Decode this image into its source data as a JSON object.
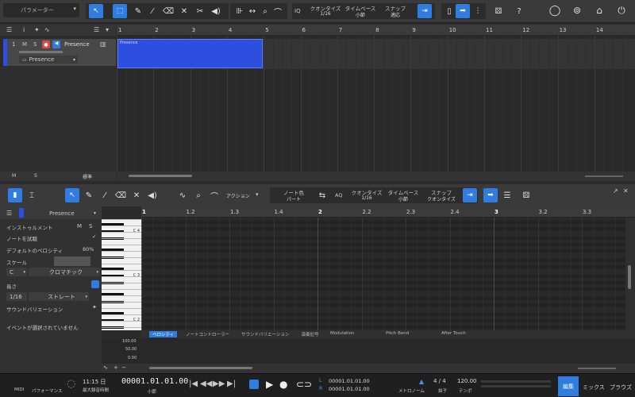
{
  "toolbar": {
    "parameter_label": "パラメーター",
    "quantize": {
      "label": "クオンタイズ",
      "value": "1/16"
    },
    "timebase": {
      "label": "タイムベース",
      "value": "小節"
    },
    "snap": {
      "label": "スナップ",
      "value": "適応"
    },
    "iq": "IQ",
    "help": "?"
  },
  "track": {
    "number": "1",
    "mute": "M",
    "solo": "S",
    "name": "Presence",
    "instrument": "Presence",
    "footer_m": "M",
    "footer_s": "S",
    "footer_std": "標準"
  },
  "arrange": {
    "ruler": [
      "1",
      "2",
      "3",
      "4",
      "5",
      "6",
      "7",
      "8",
      "9",
      "10",
      "11",
      "12",
      "13",
      "14"
    ],
    "event_label": "Presence"
  },
  "editor": {
    "instrument_name": "Presence",
    "action_label": "アクション",
    "note_color": {
      "label": "ノート色",
      "value": "パート"
    },
    "aq": "AQ",
    "quantize": {
      "label": "クオンタイズ",
      "value": "1/16"
    },
    "timebase": {
      "label": "タイムベース",
      "value": "小節"
    },
    "snap": {
      "label": "スナップ",
      "value": "クオンタイズ"
    },
    "inspector": {
      "instrument": "インストゥルメント",
      "m": "M",
      "s": "S",
      "audition": "ノートを試聴",
      "default_velocity": "デフォルトのベロシティ",
      "default_velocity_value": "80%",
      "scale": "スケール",
      "scale_root": "C",
      "scale_type": "クロマチック",
      "length": "長さ",
      "length_value": "1/16",
      "length_mode": "ストレート",
      "sound_variation": "サウンドバリエーション",
      "no_event": "イベントが選択されていません"
    },
    "ruler": [
      "1",
      "1.2",
      "1.3",
      "1.4",
      "2",
      "2.2",
      "2.3",
      "2.4",
      "3",
      "3.2",
      "3.3"
    ],
    "keys": [
      "C 4",
      "C 3",
      "C 2"
    ],
    "lane_tabs": [
      "ベロシティ",
      "ノートコントローラー",
      "サウンドバリエーション",
      "演奏記号",
      "Modulation",
      "Pitch Bend",
      "After Touch"
    ],
    "lane_values": [
      "100.00",
      "50.00",
      "0.00"
    ]
  },
  "transport": {
    "midi": "MIDI",
    "performance": "パフォーマンス",
    "time": "11:15 日",
    "max_rec": "最大録音時間",
    "position": "00001.01.01.00",
    "position_unit": "小節",
    "l_label": "L",
    "r_label": "R",
    "loop_start": "00001.01.01.00",
    "loop_end": "00001.01.01.00",
    "metronome": "メトロノーム",
    "signature": "4 / 4",
    "signature_label": "拍子",
    "tempo": "120.00",
    "tempo_label": "テンポ",
    "edit": "編集",
    "mix": "ミックス",
    "browse": "ブラウズ"
  },
  "colors": {
    "accent": "#2f7de1",
    "event": "#2d4fe0",
    "record": "#e04848"
  }
}
